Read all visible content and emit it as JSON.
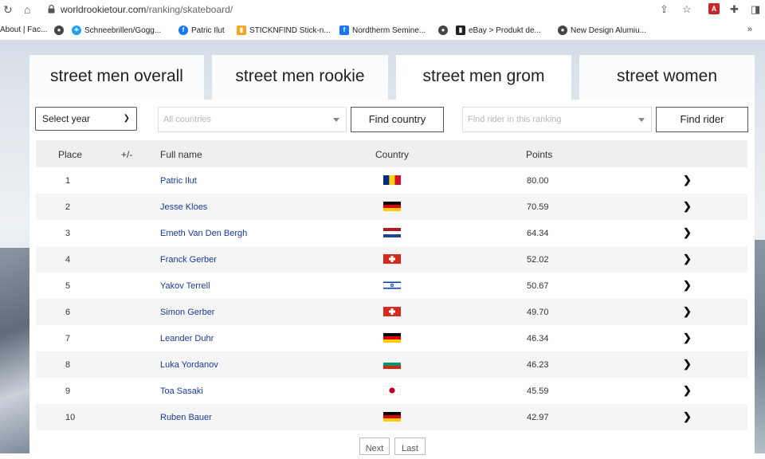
{
  "browser": {
    "url_host": "worldrookietour.com",
    "url_path": "/ranking/skateboard/",
    "bookmarks": [
      {
        "label": "About | Fac..."
      },
      {
        "label": "Schneebrillen/Gogg..."
      },
      {
        "label": "Patric Ilut"
      },
      {
        "label": "STICKNFIND Stick-n..."
      },
      {
        "label": "Nordtherm Semine..."
      },
      {
        "label": "eBay > Produkt de..."
      },
      {
        "label": "New Design Alumiu..."
      }
    ],
    "more": "»"
  },
  "tabs": [
    {
      "label": "street men overall",
      "active": false
    },
    {
      "label": "street men rookie",
      "active": false
    },
    {
      "label": "street men grom",
      "active": true
    },
    {
      "label": "street women",
      "active": false
    }
  ],
  "filters": {
    "year": "Select year",
    "country_placeholder": "All countries",
    "find_country": "Find country",
    "rider_placeholder": "Find rider in this ranking",
    "find_rider": "Find rider"
  },
  "table": {
    "headers": {
      "place": "Place",
      "change": "+/-",
      "name": "Full name",
      "country": "Country",
      "points": "Points"
    },
    "rows": [
      {
        "place": "1",
        "name": "Patric Ilut",
        "flag": "romania",
        "points": "80.00"
      },
      {
        "place": "2",
        "name": "Jesse Kloes",
        "flag": "germany",
        "points": "70.59"
      },
      {
        "place": "3",
        "name": "Emeth Van Den Bergh",
        "flag": "netherlands",
        "points": "64.34"
      },
      {
        "place": "4",
        "name": "Franck Gerber",
        "flag": "switzerland",
        "points": "52.02"
      },
      {
        "place": "5",
        "name": "Yakov Terrell",
        "flag": "israel",
        "points": "50.67"
      },
      {
        "place": "6",
        "name": "Simon Gerber",
        "flag": "switzerland",
        "points": "49.70"
      },
      {
        "place": "7",
        "name": "Leander Duhr",
        "flag": "germany",
        "points": "46.34"
      },
      {
        "place": "8",
        "name": "Luka Yordanov",
        "flag": "bulgaria",
        "points": "46.23"
      },
      {
        "place": "9",
        "name": "Toa Sasaki",
        "flag": "japan",
        "points": "45.59"
      },
      {
        "place": "10",
        "name": "Ruben Bauer",
        "flag": "germany",
        "points": "42.97"
      }
    ]
  },
  "pager": {
    "next": "Next",
    "last": "Last"
  }
}
